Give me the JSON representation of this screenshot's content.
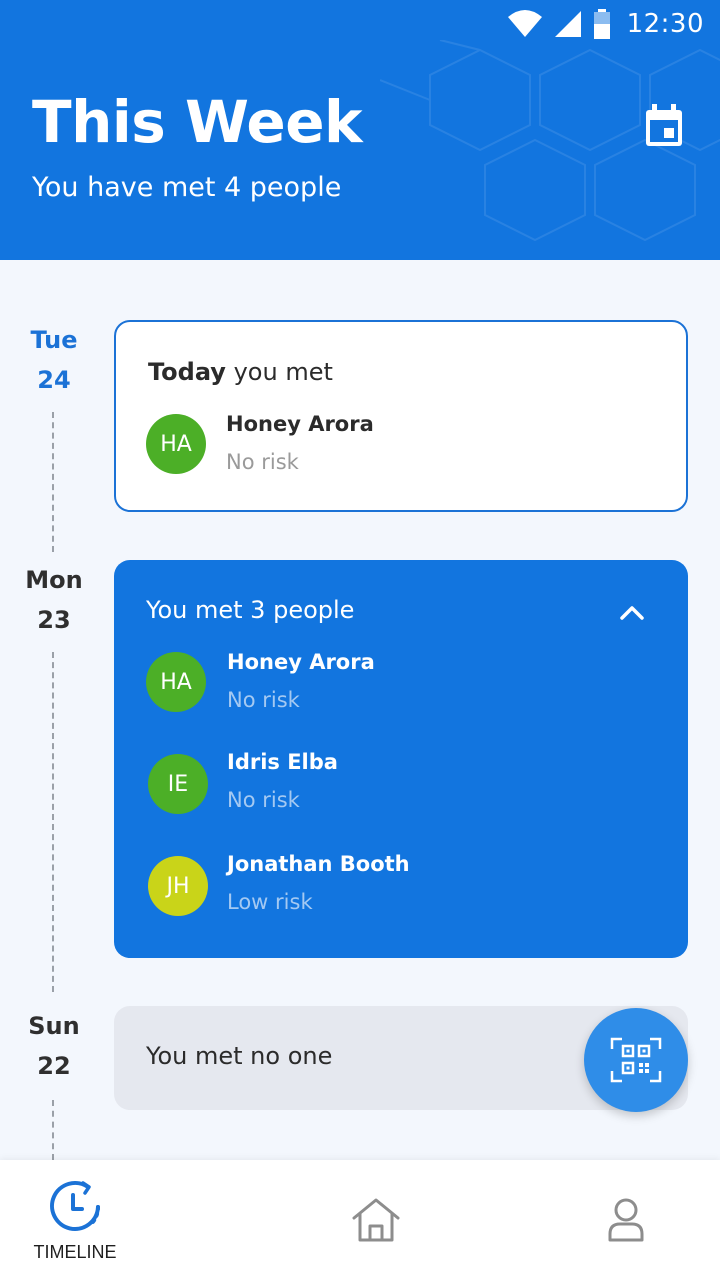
{
  "status_bar": {
    "time": "12:30"
  },
  "header": {
    "title": "This Week",
    "subtitle": "You have met 4 people"
  },
  "days": [
    {
      "dow": "Tue",
      "date": "24"
    },
    {
      "dow": "Mon",
      "date": "23"
    },
    {
      "dow": "Sun",
      "date": "22"
    }
  ],
  "today_card": {
    "heading_bold": "Today",
    "heading_rest": "you met",
    "people": [
      {
        "initials": "HA",
        "name": "Honey Arora",
        "risk": "No risk",
        "color": "#4caf27"
      }
    ]
  },
  "mon_card": {
    "heading": "You met 3 people",
    "people": [
      {
        "initials": "HA",
        "name": "Honey Arora",
        "risk": "No risk",
        "color": "#4caf27"
      },
      {
        "initials": "IE",
        "name": "Idris Elba",
        "risk": "No risk",
        "color": "#4caf27"
      },
      {
        "initials": "JH",
        "name": "Jonathan Booth",
        "risk": "Low risk",
        "color": "#c9d419"
      }
    ]
  },
  "sun_card": {
    "text": "You met no one"
  },
  "nav": {
    "timeline_label": "TIMELINE"
  },
  "colors": {
    "primary": "#1275df",
    "accent": "#1b72d6",
    "fab": "#2f8de8"
  },
  "icons": {
    "calendar": "calendar-icon",
    "collapse": "chevron-up-icon",
    "fab": "qr-code-scan-icon",
    "timeline": "timeline-clock-icon",
    "home": "home-icon",
    "profile": "profile-icon"
  }
}
